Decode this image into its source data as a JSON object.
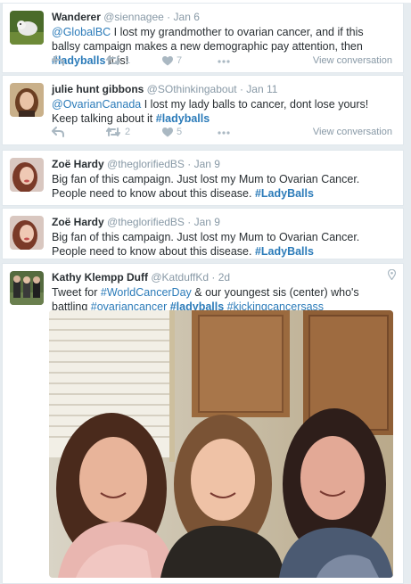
{
  "tweets": [
    {
      "name": "Wanderer",
      "handle": "@siennagee",
      "date": "Jan 6",
      "mention": "@GlobalBC",
      "text1": " I lost my grandmother to ovarian cancer, and if this ballsy campaign makes a new demographic pay attention, then ",
      "hashtag": "#ladyballs",
      "text2": " it is!",
      "retweets": "1",
      "likes": "7",
      "view_conversation": "View conversation"
    },
    {
      "name": "julie hunt gibbons",
      "handle": "@SOthinkingabout",
      "date": "Jan 11",
      "mention": "@OvarianCanada",
      "text1": " I lost my lady balls to cancer, dont lose yours! Keep talking about it ",
      "hashtag": "#ladyballs",
      "retweets": "2",
      "likes": "5",
      "view_conversation": "View conversation"
    },
    {
      "name": "Zoë Hardy",
      "handle": "@theglorifiedBS",
      "date": "Jan 9",
      "text1": "Big fan of this campaign. Just lost my Mum to Ovarian Cancer. People need to know about this disease. ",
      "hashtag": "#LadyBalls"
    },
    {
      "name": "Zoë Hardy",
      "handle": "@theglorifiedBS",
      "date": "Jan 9",
      "text1": "Big fan of this campaign. Just lost my Mum to Ovarian Cancer. People need to know about this disease. ",
      "hashtag": "#LadyBalls"
    },
    {
      "name": "Kathy Klempp Duff",
      "handle": "@KatduffKd",
      "date": "2d",
      "text1": "Tweet for ",
      "hashtag1": "#WorldCancerDay",
      "text2": " & our youngest sis (center) who's battling ",
      "hashtag2": "#ovariancancer",
      "hashtag3": "#ladyballs",
      "hashtag4": "#kickingcancersass"
    }
  ],
  "dot": "·",
  "colors": {
    "link": "#2b7bb9",
    "muted": "#8899a6",
    "icon": "#aab8c2",
    "text": "#292f33"
  },
  "icons": [
    "reply-icon",
    "retweet-icon",
    "heart-icon",
    "more-icon",
    "location-pin-icon"
  ]
}
